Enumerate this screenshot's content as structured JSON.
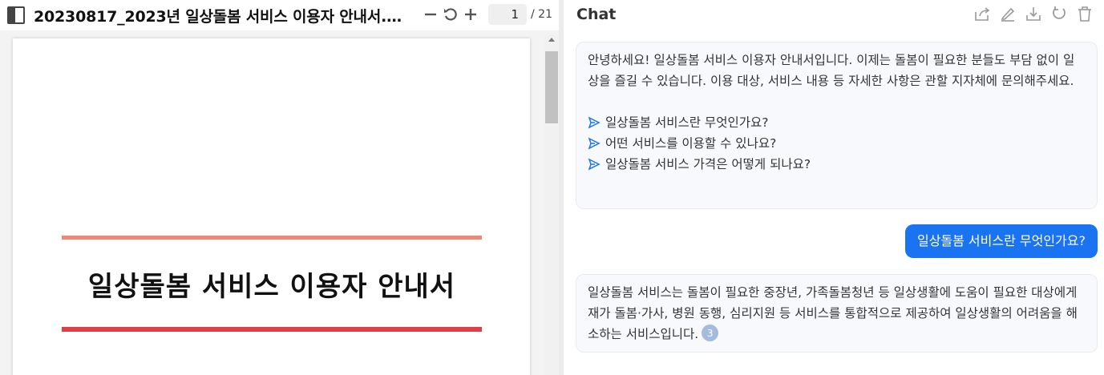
{
  "pdf": {
    "title": "20230817_2023년 일상돌봄 서비스 이용자 안내서.pdf",
    "toolbar": {
      "zoom_out_icon": "minus-icon",
      "rotate_icon": "rotate-ccw-icon",
      "zoom_in_icon": "plus-icon",
      "current_page": "1",
      "total_pages": "/ 21"
    },
    "page": {
      "heading": "일상돌봄 서비스 이용자 안내서",
      "rule_top_color": "#ec8a78",
      "rule_bottom_color": "#e23e45"
    }
  },
  "chat": {
    "title": "Chat",
    "actions": [
      "share-icon",
      "edit-icon",
      "download-icon",
      "refresh-icon",
      "trash-icon"
    ],
    "messages": [
      {
        "role": "assistant",
        "text": "안녕하세요! 일상돌봄 서비스 이용자 안내서입니다. 이제는 돌봄이 필요한 분들도 부담 없이 일상을 즐길 수 있습니다. 이용 대상, 서비스 내용 등 자세한 사항은 관할 지자체에 문의해주세요.",
        "suggestions": [
          "일상돌봄 서비스란 무엇인가요?",
          "어떤 서비스를 이용할 수 있나요?",
          "일상돌봄 서비스 가격은 어떻게 되나요?"
        ]
      },
      {
        "role": "user",
        "text": "일상돌봄 서비스란 무엇인가요?"
      },
      {
        "role": "assistant",
        "text": "일상돌봄 서비스는 돌봄이 필요한 중장년, 가족돌봄청년 등 일상생활에 도움이 필요한 대상에게 재가 돌봄·가사, 병원 동행, 심리지원 등 서비스를 통합적으로 제공하여 일상생활의 어려움을 해소하는 서비스입니다.",
        "citation": "3"
      }
    ],
    "accent_color": "#1a73f0"
  }
}
